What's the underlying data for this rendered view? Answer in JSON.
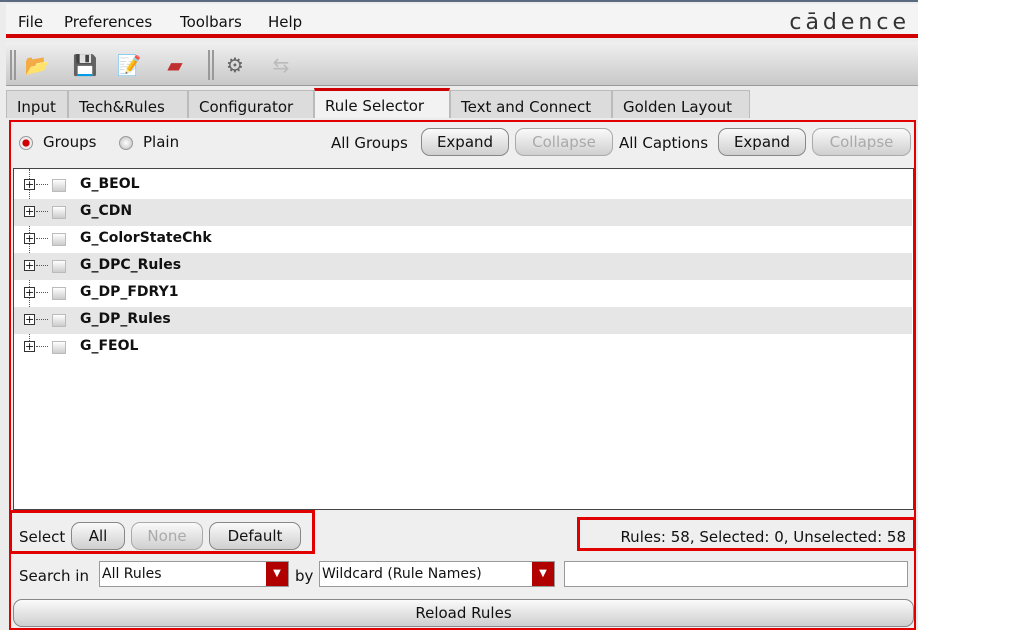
{
  "menu": {
    "items": [
      "File",
      "Preferences",
      "Toolbars",
      "Help"
    ],
    "logo": "cādence"
  },
  "toolbar": {
    "icons": [
      "open-folder-icon",
      "save-icon",
      "edit-icon",
      "eraser-icon",
      "settings-gears-icon",
      "import-icon"
    ]
  },
  "tabs": [
    "Input",
    "Tech&Rules",
    "Configurator",
    "Rule Selector",
    "Text and Connect",
    "Golden Layout"
  ],
  "active_tab": "Rule Selector",
  "view": {
    "groups": "Groups",
    "plain": "Plain",
    "selected": "Groups"
  },
  "all_groups": {
    "label": "All Groups",
    "expand": "Expand",
    "collapse": "Collapse"
  },
  "all_captions": {
    "label": "All Captions",
    "expand": "Expand",
    "collapse": "Collapse"
  },
  "tree": [
    "G_BEOL",
    "G_CDN",
    "G_ColorStateChk",
    "G_DPC_Rules",
    "G_DP_FDRY1",
    "G_DP_Rules",
    "G_FEOL"
  ],
  "select": {
    "label": "Select",
    "all": "All",
    "none": "None",
    "default": "Default"
  },
  "status": "Rules: 58, Selected: 0, Unselected: 58",
  "search": {
    "label": "Search in",
    "scope": "All Rules",
    "by": "by",
    "mode": "Wildcard (Rule Names)",
    "value": ""
  },
  "reload": "Reload Rules",
  "colors": {
    "accent": "#d00000",
    "highlight": "#e00000"
  }
}
